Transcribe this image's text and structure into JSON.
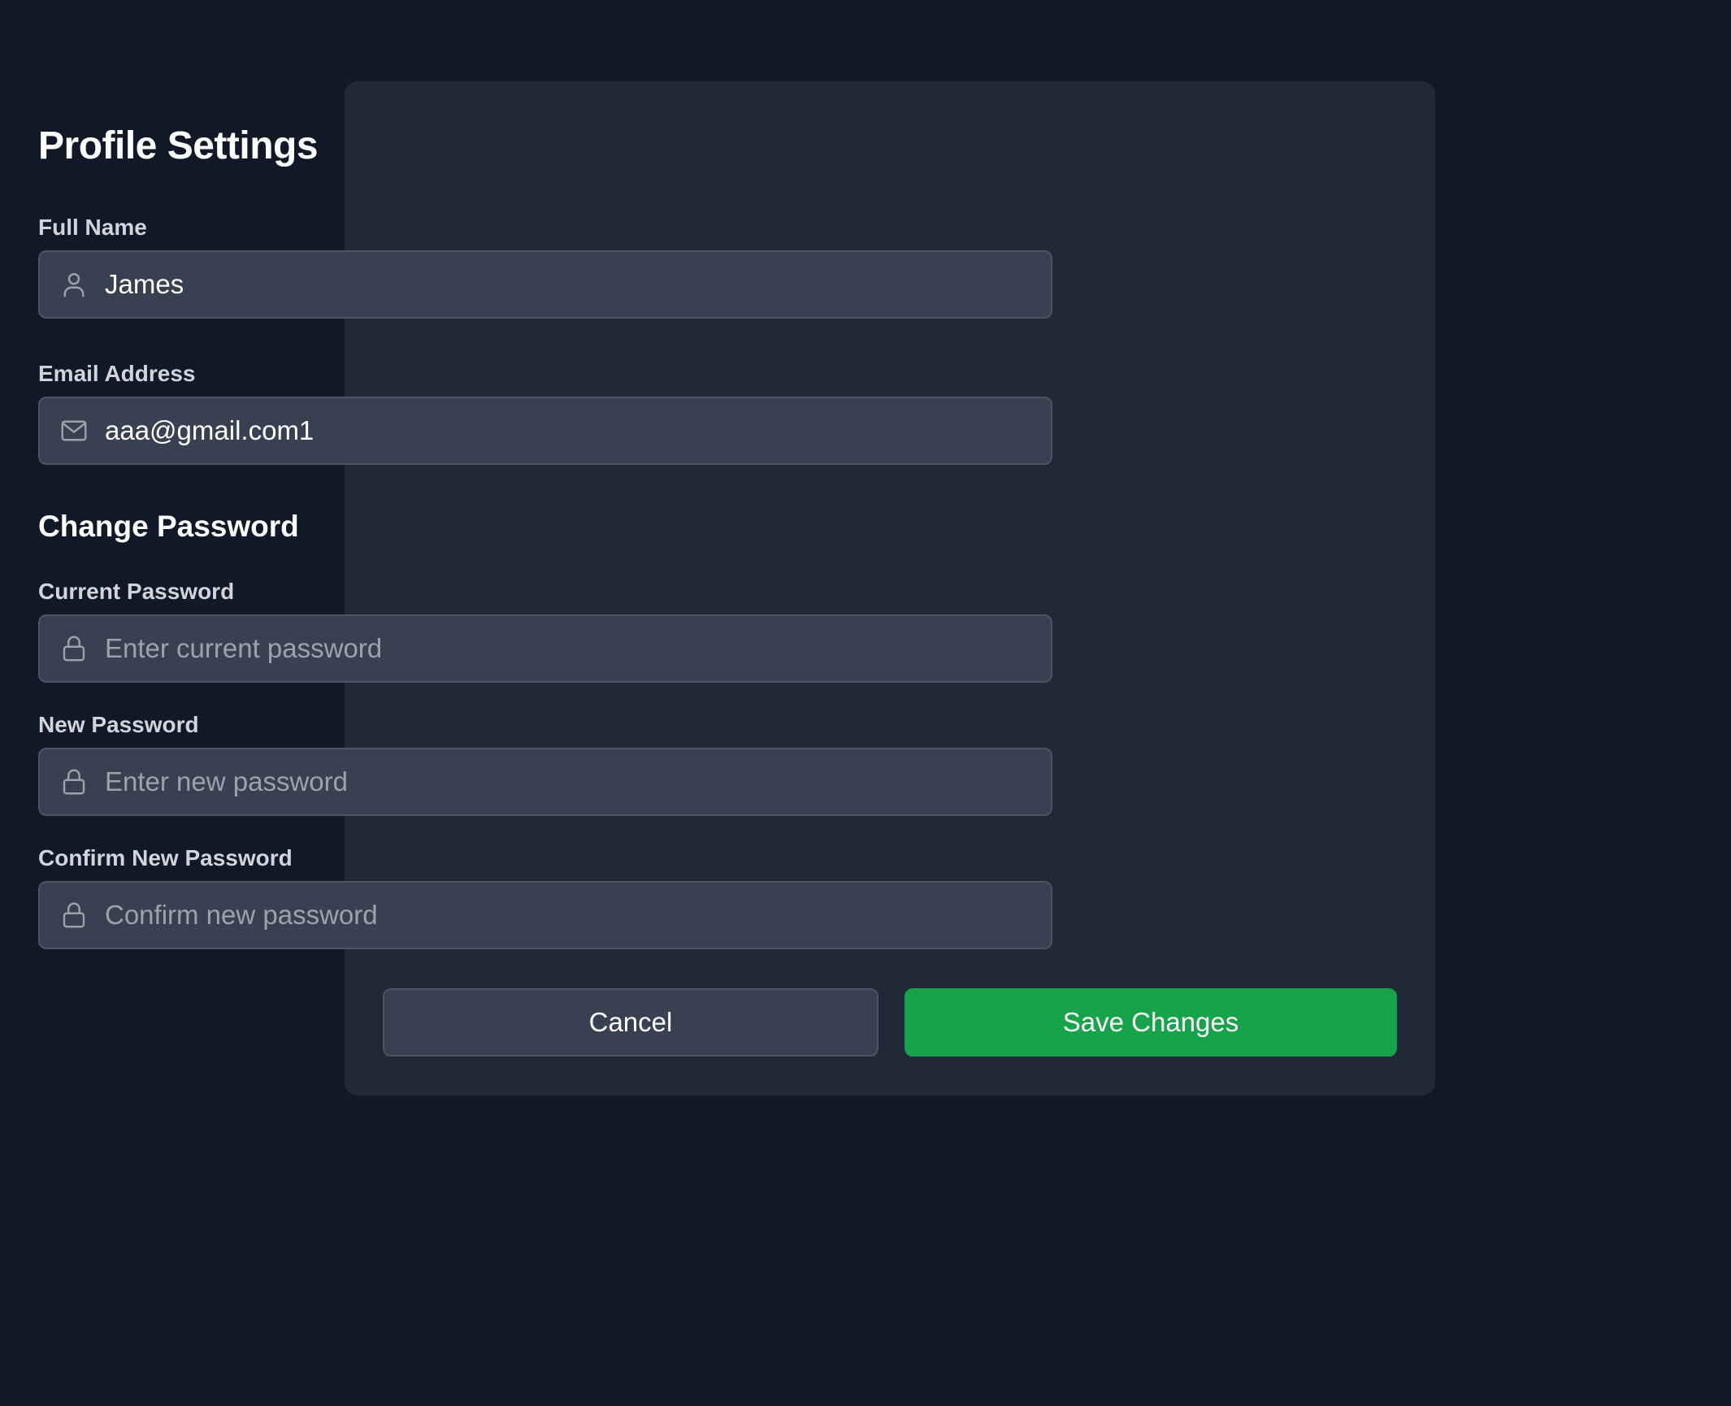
{
  "form": {
    "title": "Profile Settings",
    "full_name": {
      "label": "Full Name",
      "value": "James",
      "icon": "user-icon"
    },
    "email": {
      "label": "Email Address",
      "value": "aaa@gmail.com1",
      "icon": "mail-icon"
    },
    "password_section": {
      "title": "Change Password",
      "current": {
        "label": "Current Password",
        "placeholder": "Enter current password",
        "icon": "lock-icon"
      },
      "new": {
        "label": "New Password",
        "placeholder": "Enter new password",
        "icon": "lock-icon"
      },
      "confirm": {
        "label": "Confirm New Password",
        "placeholder": "Confirm new password",
        "icon": "lock-icon"
      }
    },
    "actions": {
      "cancel_label": "Cancel",
      "save_label": "Save Changes"
    }
  },
  "colors": {
    "page_background": "#111827",
    "card_background": "#1f2937",
    "input_background": "#374151",
    "input_border": "#4b5563",
    "label_text": "#d1d5db",
    "placeholder_text": "#9ca3af",
    "primary_button": "#16a34a"
  }
}
